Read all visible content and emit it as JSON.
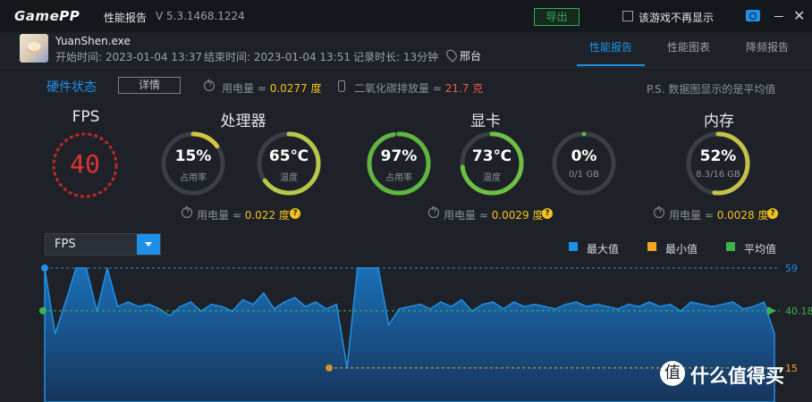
{
  "titlebar": {
    "logo_left": "Game",
    "logo_right": "PP",
    "title": "性能报告",
    "version": "V 5.3.1468.1224",
    "export_label": "导出",
    "no_show_label": "该游戏不再显示"
  },
  "session": {
    "exe": "YuanShen.exe",
    "start": "开始时间: 2023-01-04 13:37",
    "end": "结束时间: 2023-01-04 13:51",
    "duration": "记录时长: 13分钟",
    "location": "邢台"
  },
  "tabs": [
    "性能报告",
    "性能图表",
    "降频报告"
  ],
  "hardware": {
    "title": "硬件状态",
    "detail_label": "详情",
    "power_label": "用电量 ≈ ",
    "power_value": "0.0277 度",
    "co2_label": "二氧化碳排放量 ≈ ",
    "co2_value": "21.7 克",
    "note": "P.S. 数据图显示的是平均值"
  },
  "sections": {
    "fps": {
      "title": "FPS",
      "value": "40"
    },
    "cpu": {
      "title": "处理器",
      "usage": "15%",
      "usage_label": "占用率",
      "usage_pct": 15,
      "temp": "65℃",
      "temp_label": "温度",
      "temp_pct": 65,
      "power_label": "用电量 ≈ ",
      "power_value": "0.022 度"
    },
    "gpu": {
      "title": "显卡",
      "usage": "97%",
      "usage_label": "占用率",
      "usage_pct": 97,
      "temp": "73℃",
      "temp_label": "温度",
      "temp_pct": 73,
      "vram": "0%",
      "vram_label": "0/1 GB",
      "vram_pct": 0,
      "power_label": "用电量 ≈ ",
      "power_value": "0.0029 度"
    },
    "mem": {
      "title": "内存",
      "usage": "52%",
      "usage_label": "8.3/16 GB",
      "usage_pct": 52,
      "power_label": "用电量 ≈ ",
      "power_value": "0.0028 度"
    }
  },
  "chart": {
    "selector": "FPS",
    "legend": [
      {
        "label": "最大值",
        "color": "#1e90e8"
      },
      {
        "label": "最小值",
        "color": "#f5a623"
      },
      {
        "label": "平均值",
        "color": "#3cb44b"
      }
    ]
  },
  "chart_data": {
    "type": "area",
    "series": [
      {
        "values": [
          59,
          30,
          44,
          59,
          59,
          40,
          59,
          42,
          44,
          42,
          43,
          41,
          38,
          42,
          44,
          40,
          43,
          42,
          40,
          45,
          43,
          48,
          41,
          44,
          46,
          42,
          44,
          41,
          43,
          15,
          59,
          59,
          59,
          34,
          41,
          42,
          43,
          41,
          44,
          42,
          45,
          40,
          43,
          44,
          41,
          44,
          42,
          43,
          42,
          41,
          43,
          44,
          42,
          43,
          42,
          41,
          43,
          42,
          44,
          42,
          43,
          40,
          44,
          43,
          42,
          43,
          44,
          41,
          42,
          44,
          30
        ]
      }
    ],
    "max": 59,
    "min": 15,
    "avg": 40.18,
    "ylim": [
      0,
      59
    ],
    "tick_labels": [
      "59",
      "40.18",
      "15"
    ]
  },
  "watermark": {
    "symbol": "值",
    "text": "什么值得买"
  }
}
